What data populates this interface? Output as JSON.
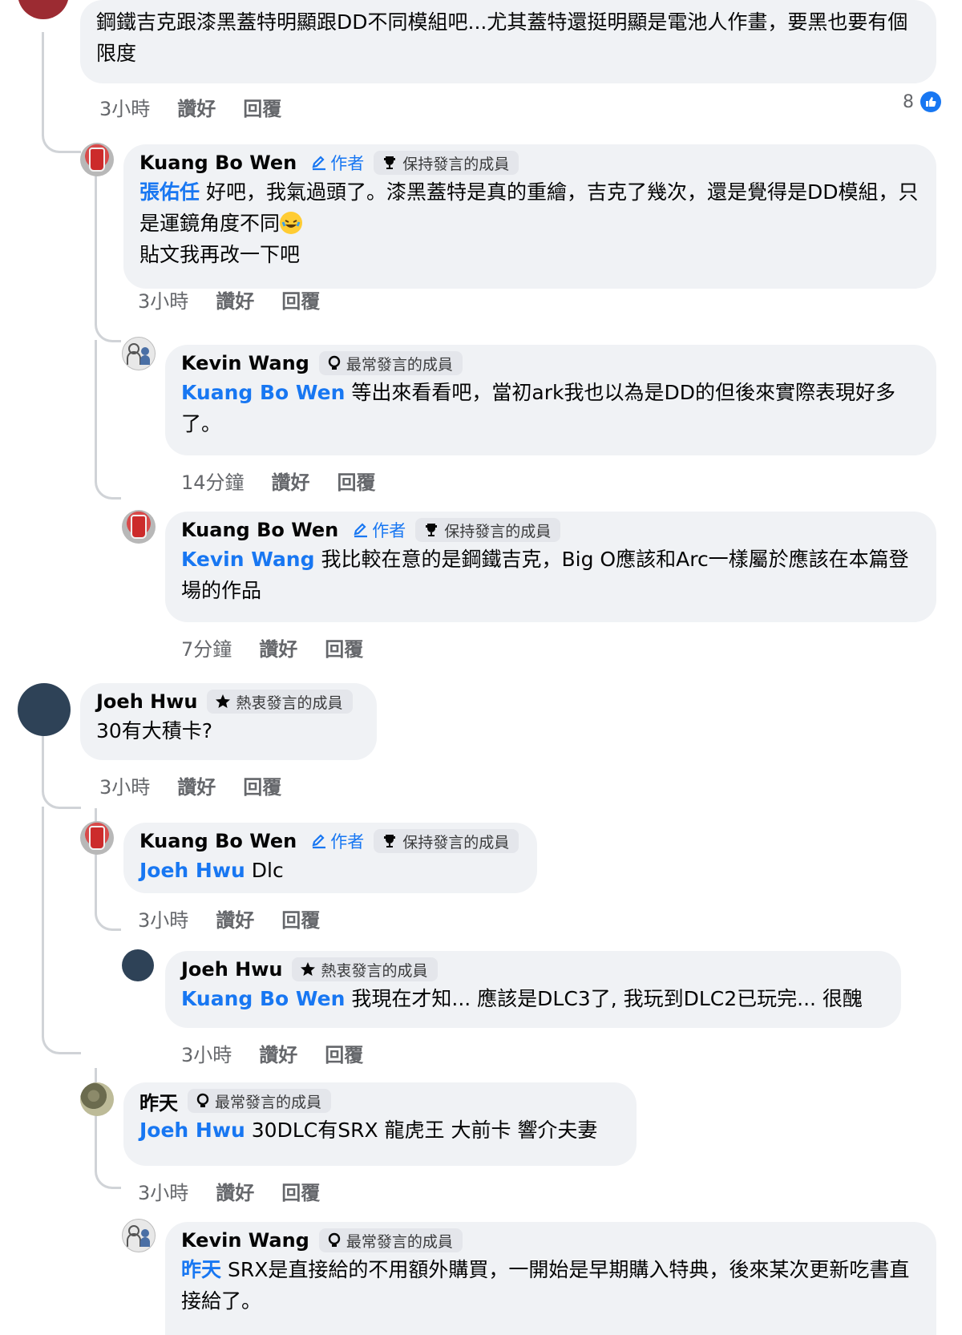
{
  "comments": [
    {
      "id": "c1",
      "text": "鋼鐵吉克跟漆黑蓋特明顯跟DD不同模組吧...尤其蓋特還挺明顯是電池人作畫，要黑也要有個限度",
      "time": "3小時",
      "like_label": "讚好",
      "reply_label": "回覆",
      "like_count": "8",
      "avatar_icon": "user-avatar"
    },
    {
      "id": "c2",
      "author": "Kuang Bo Wen",
      "author_tag": "作者",
      "badge": "保持發言的成員",
      "badge_icon": "trophy-icon",
      "mention": "張佑任",
      "text": "好吧，我氣過頭了。漆黑蓋特是真的重繪，吉克了幾次，還是覺得是DD模組，只是運鏡角度不同",
      "emoji": "laughing-emoji",
      "text2": "貼文我再改一下吧",
      "time": "3小時",
      "like_label": "讚好",
      "reply_label": "回覆"
    },
    {
      "id": "c3",
      "author": "Kevin Wang",
      "badge": "最常發言的成員",
      "badge_icon": "bulb-icon",
      "mention": "Kuang Bo Wen",
      "text": "等出來看看吧，當初ark我也以為是DD的但後來實際表現好多了。",
      "time": "14分鐘",
      "like_label": "讚好",
      "reply_label": "回覆"
    },
    {
      "id": "c4",
      "author": "Kuang Bo Wen",
      "author_tag": "作者",
      "badge": "保持發言的成員",
      "badge_icon": "trophy-icon",
      "mention": "Kevin Wang",
      "text": "我比較在意的是鋼鐵吉克，Big O應該和Arc一樣屬於應該在本篇登場的作品",
      "time": "7分鐘",
      "like_label": "讚好",
      "reply_label": "回覆"
    },
    {
      "id": "c5",
      "author": "Joeh Hwu",
      "badge": "熱衷發言的成員",
      "badge_icon": "star-icon",
      "text": "30有大積卡?",
      "time": "3小時",
      "like_label": "讚好",
      "reply_label": "回覆"
    },
    {
      "id": "c6",
      "author": "Kuang Bo Wen",
      "author_tag": "作者",
      "badge": "保持發言的成員",
      "badge_icon": "trophy-icon",
      "mention": "Joeh Hwu",
      "text": "Dlc",
      "time": "3小時",
      "like_label": "讚好",
      "reply_label": "回覆"
    },
    {
      "id": "c7",
      "author": "Joeh Hwu",
      "badge": "熱衷發言的成員",
      "badge_icon": "star-icon",
      "mention": "Kuang Bo Wen",
      "text": "我現在才知... 應該是DLC3了, 我玩到DLC2已玩完... 很醜",
      "time": "3小時",
      "like_label": "讚好",
      "reply_label": "回覆"
    },
    {
      "id": "c8",
      "author": "昨天",
      "badge": "最常發言的成員",
      "badge_icon": "bulb-icon",
      "mention": "Joeh Hwu",
      "text": "30DLC有SRX 龍虎王 大前卡 響介夫妻",
      "time": "3小時",
      "like_label": "讚好",
      "reply_label": "回覆"
    },
    {
      "id": "c9",
      "author": "Kevin Wang",
      "badge": "最常發言的成員",
      "badge_icon": "bulb-icon",
      "mention": "昨天",
      "text": "SRX是直接給的不用額外購買，一開始是早期購入特典，後來某次更新吃書直接給了。"
    }
  ]
}
